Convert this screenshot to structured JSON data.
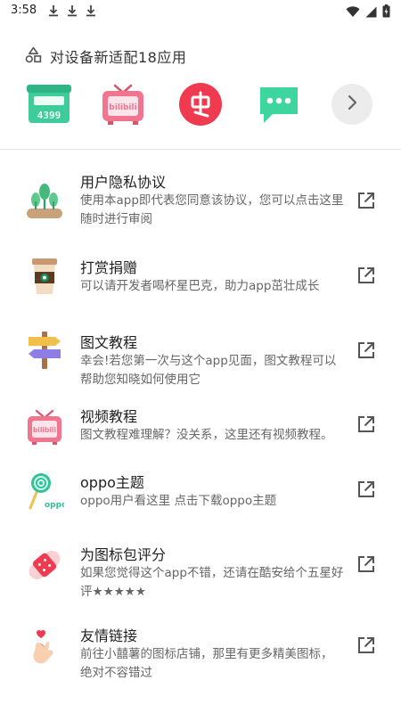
{
  "status_bar": {
    "time": "3:58",
    "download_icons": [
      "download-icon",
      "download-icon",
      "download-icon"
    ],
    "right_icons": [
      "wifi-icon",
      "signal-icon",
      "battery-charging-icon"
    ]
  },
  "adapt_header": {
    "icon": "shapes-icon",
    "text": "对设备新适配18应用"
  },
  "adapted_apps": [
    {
      "name": "calculator-app-icon",
      "color": "#3dcc9a"
    },
    {
      "name": "bilibili-tv-app-icon",
      "color": "#f2758f"
    },
    {
      "name": "bug-app-icon",
      "color": "#ef3a50"
    },
    {
      "name": "messages-app-icon",
      "color": "#3ed69f"
    }
  ],
  "more_button_icon": "chevron-right-icon",
  "items": [
    {
      "icon": "plant-icon",
      "title": "用户隐私协议",
      "desc": "使用本app即代表您同意该协议，您可以点击这里随时进行审阅"
    },
    {
      "icon": "coffee-cup-icon",
      "title": "打赏捐赠",
      "desc": "可以请开发者喝杯星巴克，助力app茁壮成长"
    },
    {
      "icon": "signpost-icon",
      "title": "图文教程",
      "desc": "幸会!若您第一次与这个app见面，图文教程可以帮助您知晓如何使用它"
    },
    {
      "icon": "bilibili-tv-icon",
      "title": "视频教程",
      "desc": "图文教程难理解？没关系，这里还有视频教程。"
    },
    {
      "icon": "lollipop-icon",
      "title": "oppo主题",
      "desc": "oppo用户看这里 点击下载oppo主题"
    },
    {
      "icon": "bandage-icon",
      "title": "为图标包评分",
      "desc": "如果您觉得这个app不错，还请在酷安给个五星好评★★★★★"
    },
    {
      "icon": "finger-heart-icon",
      "title": "友情链接",
      "desc": "前往小囍薯的图标店铺，那里有更多精美图标，绝对不容错过"
    }
  ],
  "colors": {
    "green": "#3dcc9a",
    "pink": "#f2758f",
    "red": "#ef3a50",
    "icon_gray": "#555555"
  }
}
